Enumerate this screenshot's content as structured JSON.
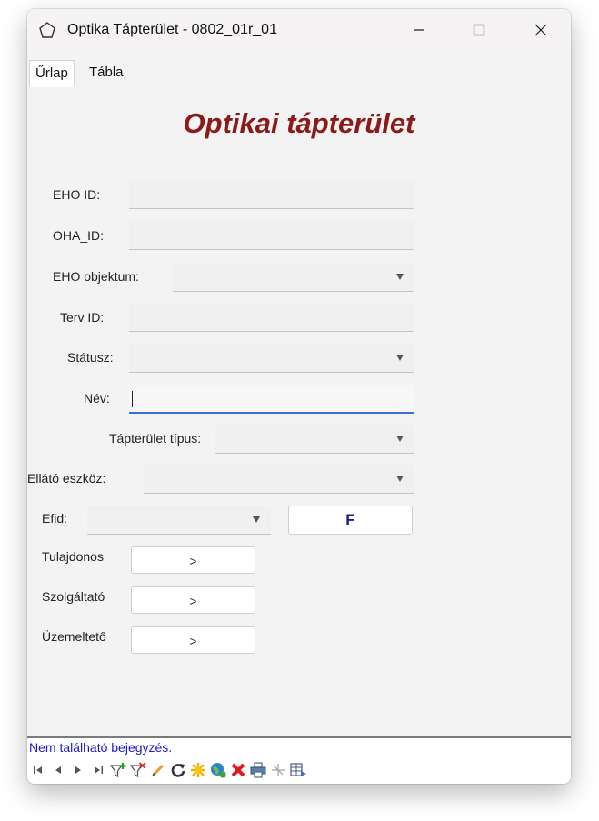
{
  "window": {
    "title": "Optika Tápterület - 0802_01r_01"
  },
  "tabs": [
    {
      "label": "Űrlap"
    },
    {
      "label": "Tábla"
    }
  ],
  "form": {
    "title": "Optikai tápterület",
    "eho_id": {
      "label": "EHO ID:",
      "value": ""
    },
    "oha_id": {
      "label": "OHA_ID:",
      "value": ""
    },
    "eho_objektum": {
      "label": "EHO objektum:",
      "value": ""
    },
    "terv_id": {
      "label": "Terv ID:",
      "value": ""
    },
    "statusz": {
      "label": "Státusz:",
      "value": ""
    },
    "nev": {
      "label": "Név:",
      "value": ""
    },
    "tapterulet_tipus": {
      "label": "Tápterület típus:",
      "value": ""
    },
    "ellato_eszkoz": {
      "label": "Ellátó eszköz:",
      "value": ""
    },
    "efid": {
      "label": "Efid:",
      "value": "",
      "button_label": "F"
    },
    "tulajdonos": {
      "label": "Tulajdonos",
      "button_label": ">"
    },
    "szolgaltato": {
      "label": "Szolgáltató",
      "button_label": ">"
    },
    "uzemelteto": {
      "label": "Üzemeltető",
      "button_label": ">"
    }
  },
  "status": {
    "text": "Nem található bejegyzés."
  },
  "toolbar": {
    "icons": [
      "first-record-icon",
      "previous-record-icon",
      "next-record-icon",
      "last-record-icon",
      "filter-add-icon",
      "filter-remove-icon",
      "edit-icon",
      "refresh-icon",
      "new-record-icon",
      "web-icon",
      "delete-icon",
      "print-icon",
      "move-icon",
      "table-export-icon"
    ]
  }
}
